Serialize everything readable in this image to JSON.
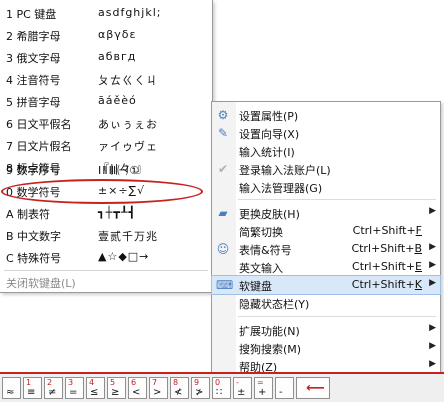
{
  "kb_menu": {
    "items": [
      {
        "label": "1 PC 键盘",
        "sample": "asdfghjkl;"
      },
      {
        "label": "2 希腊字母",
        "sample": "αβγδε"
      },
      {
        "label": "3 俄文字母",
        "sample": "абвгд"
      },
      {
        "label": "4 注音符号",
        "sample": "ㄆㄊㄍㄑㄐ"
      },
      {
        "label": "5 拼音字母",
        "sample": "āáěèó"
      },
      {
        "label": "6 日文平假名",
        "sample": "あぃぅぇお"
      },
      {
        "label": "7 日文片假名",
        "sample": "ァイゥヴェ"
      },
      {
        "label": "8 标点符号",
        "sample": "『||々·』"
      },
      {
        "label": "9 数字序号",
        "sample": "ⅠⅡⅢ㈠①"
      },
      {
        "label": "0 数学符号",
        "sample": "±×÷∑√"
      },
      {
        "label": "A 制表符",
        "sample": "┓┼┳┸┫"
      },
      {
        "label": "B 中文数字",
        "sample": "壹贰千万兆"
      },
      {
        "label": "C 特殊符号",
        "sample": "▲☆◆□→"
      }
    ],
    "close_label": "关闭软键盘(L)"
  },
  "ctx_menu": {
    "items": [
      {
        "icon": "gear-icon",
        "glyph": "⚙",
        "label": "设置属性(P)",
        "shortcut": "",
        "arrow": false
      },
      {
        "icon": "wizard-icon",
        "glyph": "✎",
        "label": "设置向导(X)",
        "shortcut": "",
        "arrow": false
      },
      {
        "icon": "",
        "glyph": "",
        "label": "输入统计(I)",
        "shortcut": "",
        "arrow": false
      },
      {
        "icon": "check-circle-icon",
        "glyph": "✔",
        "label": "登录输入法账户(L)",
        "shortcut": "",
        "arrow": false
      },
      {
        "icon": "",
        "glyph": "",
        "label": "输入法管理器(G)",
        "shortcut": "",
        "arrow": false
      },
      {
        "icon": "skin-icon",
        "glyph": "▰",
        "label": "更换皮肤(H)",
        "shortcut": "",
        "arrow": true
      },
      {
        "icon": "",
        "glyph": "",
        "label": "简繁切换",
        "shortcut": "Ctrl+Shift+F",
        "arrow": false
      },
      {
        "icon": "smiley-icon",
        "glyph": "☺",
        "label": "表情&符号",
        "shortcut": "Ctrl+Shift+B",
        "arrow": true
      },
      {
        "icon": "",
        "glyph": "",
        "label": "英文输入",
        "shortcut": "Ctrl+Shift+E",
        "arrow": true
      },
      {
        "icon": "keyboard-icon",
        "glyph": "⌨",
        "label": "软键盘",
        "shortcut": "Ctrl+Shift+K",
        "arrow": true
      },
      {
        "icon": "",
        "glyph": "",
        "label": "隐藏状态栏(Y)",
        "shortcut": "",
        "arrow": false
      },
      {
        "icon": "",
        "glyph": "",
        "label": "扩展功能(N)",
        "shortcut": "",
        "arrow": true
      },
      {
        "icon": "",
        "glyph": "",
        "label": "搜狗搜索(M)",
        "shortcut": "",
        "arrow": true
      },
      {
        "icon": "",
        "glyph": "",
        "label": "帮助(Z)",
        "shortcut": "",
        "arrow": true
      }
    ]
  },
  "kb_strip": {
    "keys": [
      {
        "num": "",
        "sym": "≈"
      },
      {
        "num": "1",
        "sym": "≡"
      },
      {
        "num": "2",
        "sym": "≠"
      },
      {
        "num": "3",
        "sym": "="
      },
      {
        "num": "4",
        "sym": "≤"
      },
      {
        "num": "5",
        "sym": "≥"
      },
      {
        "num": "6",
        "sym": "<"
      },
      {
        "num": "7",
        "sym": ">"
      },
      {
        "num": "8",
        "sym": "≮"
      },
      {
        "num": "9",
        "sym": "≯"
      },
      {
        "num": "0",
        "sym": "∷"
      },
      {
        "num": "-",
        "sym": "±"
      },
      {
        "num": "=",
        "sym": "+"
      },
      {
        "num": "",
        "sym": "-"
      }
    ],
    "backspace_glyph": "⟵"
  },
  "colors": {
    "accent_red": "#c8201f",
    "highlight_blue": "#d8e8f8"
  }
}
